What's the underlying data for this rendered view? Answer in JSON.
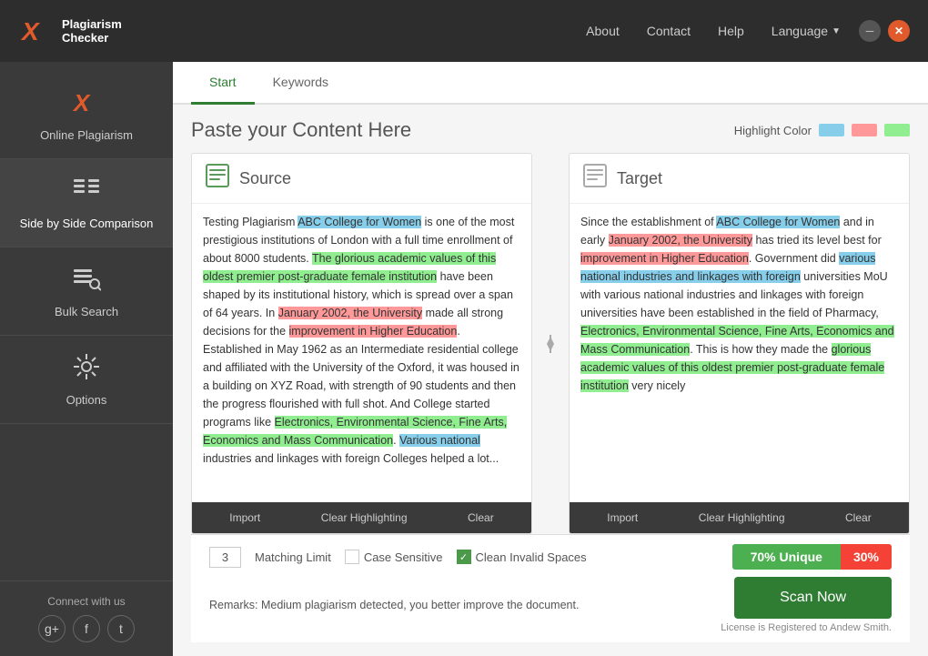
{
  "topbar": {
    "logo_line1": "Plagiarism",
    "logo_line2": "Checker",
    "logo_x": "X",
    "nav": {
      "about": "About",
      "contact": "Contact",
      "help": "Help",
      "language": "Language"
    },
    "minimize_label": "─",
    "close_label": "✕"
  },
  "sidebar": {
    "items": [
      {
        "id": "online-plagiarism",
        "label": "Online Plagiarism",
        "icon": "✕"
      },
      {
        "id": "side-by-side",
        "label": "Side by Side Comparison",
        "icon": "≡"
      },
      {
        "id": "bulk-search",
        "label": "Bulk Search",
        "icon": "≡🔍"
      },
      {
        "id": "options",
        "label": "Options",
        "icon": "⚙"
      }
    ],
    "connect": "Connect with us"
  },
  "tabs": [
    {
      "id": "start",
      "label": "Start"
    },
    {
      "id": "keywords",
      "label": "Keywords"
    }
  ],
  "page": {
    "title": "Paste your Content Here",
    "highlight_color_label": "Highlight Color"
  },
  "source_panel": {
    "title": "Source",
    "footer_buttons": [
      "Import",
      "Clear Highlighting",
      "Clear"
    ],
    "text": "Testing Plagiarism ABC College for Women is one of the most prestigious institutions of London with a full time enrollment of about 8000 students. The glorious academic values of this oldest premier post-graduate female institution have been shaped by its institutional history, which is spread over a span of 64 years. In January 2002, the University made all strong decisions for the improvement in Higher Education. Established in May 1962 as an Intermediate residential college and affiliated with the University of the Oxford, it was housed in a building on XYZ Road, with strength of 90 students and then the progress flourished with full shot. And College started programs like Electronics, Environmental Science, Fine Arts, Economics and Mass Communication. Various national industries and linkages with foreign Colleges helped a lot..."
  },
  "target_panel": {
    "title": "Target",
    "footer_buttons": [
      "Import",
      "Clear Highlighting",
      "Clear"
    ],
    "text": "Since the establishment of ABC College for Women and in early January 2002, the University has tried its level best for improvement in Higher Education. Government did various national industries and linkages with foreign universities MoU with various national industries and linkages with foreign universities have been established in the field of Pharmacy, Electronics, Environmental Science, Fine Arts, Economics and Mass Communication. This is how they made the glorious academic values of this oldest premier post-graduate female institution very nicely"
  },
  "bottom": {
    "matching_limit_value": "3",
    "matching_limit_label": "Matching Limit",
    "case_sensitive_label": "Case Sensitive",
    "case_sensitive_checked": false,
    "clean_invalid_label": "Clean Invalid Spaces",
    "clean_invalid_checked": true,
    "unique_score": "70% Unique",
    "plagiarized_score": "30%",
    "remarks": "Remarks: Medium plagiarism detected, you better improve the document.",
    "scan_button": "Scan Now",
    "license": "License is Registered to Andew Smith."
  },
  "colors": {
    "accent_green": "#2e7d32",
    "swatch1": "#87ceeb",
    "swatch2": "#ff9999",
    "swatch3": "#90ee90"
  }
}
